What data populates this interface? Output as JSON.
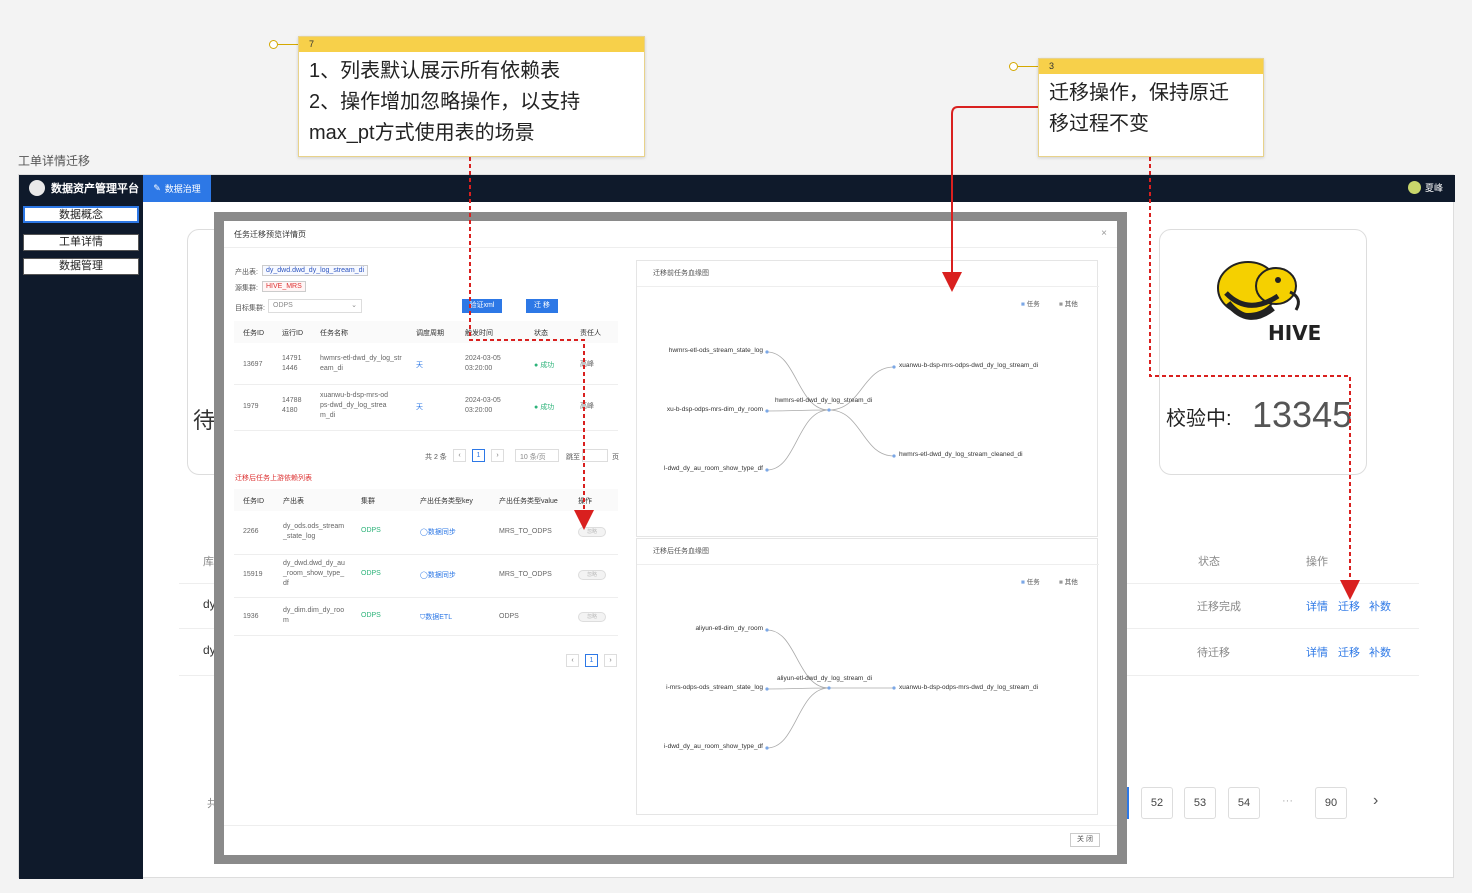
{
  "page_caption": "工单详情迁移",
  "app": {
    "brand": "数据资产管理平台",
    "top_tab": "数据治理",
    "user_name": "夏峰",
    "sidebar": [
      "数据概念",
      "工单详情",
      "数据管理"
    ]
  },
  "background": {
    "wait_label": "待",
    "verifying_label": "校验中:",
    "verifying_count": "13345",
    "hive_logo_text": "HIVE",
    "col_ku": "库",
    "col_status": "状态",
    "col_ops": "操作",
    "rows": [
      {
        "prefix": "dy",
        "status": "迁移完成",
        "ops": [
          "详情",
          "迁移",
          "补数"
        ]
      },
      {
        "prefix": "dy",
        "status": "待迁移",
        "ops": [
          "详情",
          "迁移",
          "补数"
        ]
      }
    ],
    "total_prefix": "共",
    "pages": [
      "52",
      "53",
      "54",
      "···",
      "90"
    ],
    "next_icon": "chevron-right-icon"
  },
  "modal": {
    "title": "任务迁移预览详情页",
    "close_icon": "×",
    "output_table_label": "产出表:",
    "output_table_value": "dy_dwd.dwd_dy_log_stream_di",
    "source_cluster_label": "源集群:",
    "source_cluster_value": "HIVE_MRS",
    "target_cluster_label": "目标集群:",
    "target_cluster_value": "ODPS",
    "btn_verify": "验证xml",
    "btn_migrate": "迁 移",
    "task_table": {
      "headers": [
        "任务ID",
        "运行ID",
        "任务名称",
        "调度周期",
        "触发时间",
        "状态",
        "责任人"
      ],
      "rows": [
        {
          "task_id": "13697",
          "run_id": "14791 1446",
          "name": "hwmrs-etl-dwd_dy_log_stream_di",
          "cycle": "天",
          "time": "2024-03-05 03:20:00",
          "status": "成功",
          "owner": "高峰"
        },
        {
          "task_id": "1979",
          "run_id": "14788 4180",
          "name": "xuanwu-b-dsp-mrs-odps-dwd_dy_log_stream_di",
          "cycle": "天",
          "time": "2024-03-05 03:20:00",
          "status": "成功",
          "owner": "高峰"
        }
      ],
      "total": "共 2 条",
      "page": "1",
      "page_size": "10 条/页",
      "goto": "跳至",
      "page_suffix": "页"
    },
    "dep_title": "迁移后任务上游依赖列表",
    "dep_table": {
      "headers": [
        "任务ID",
        "产出表",
        "集群",
        "产出任务类型key",
        "产出任务类型value",
        "操作"
      ],
      "rows": [
        {
          "task_id": "2266",
          "table": "dy_ods.ods_stream_state_log",
          "cluster": "ODPS",
          "type_key": "数据同步",
          "type_value": "MRS_TO_ODPS",
          "op": "忽略"
        },
        {
          "task_id": "15919",
          "table": "dy_dwd.dwd_dy_au_room_show_type_df",
          "cluster": "ODPS",
          "type_key": "数据同步",
          "type_value": "MRS_TO_ODPS",
          "op": "忽略"
        },
        {
          "task_id": "1936",
          "table": "dy_dim.dim_dy_room",
          "cluster": "ODPS",
          "type_key": "数据ETL",
          "type_value": "ODPS",
          "op": "忽略"
        }
      ],
      "page": "1"
    },
    "graph_before": {
      "title": "迁移前任务血缘图",
      "legend": [
        "任务",
        "其他"
      ],
      "center": "hwmrs-etl-dwd_dy_log_stream_di",
      "left": [
        "hwmrs-etl-ods_stream_state_log",
        "xu-b-dsp-odps-mrs-dim_dy_room",
        "l-dwd_dy_au_room_show_type_df"
      ],
      "right": [
        "xuanwu-b-dsp-mrs-odps-dwd_dy_log_stream_di",
        "hwmrs-etl-dwd_dy_log_stream_cleaned_di"
      ]
    },
    "graph_after": {
      "title": "迁移后任务血缘图",
      "legend": [
        "任务",
        "其他"
      ],
      "center": "aliyun-etl-dwd_dy_log_stream_di",
      "left": [
        "aliyun-etl-dim_dy_room",
        "i-mrs-odps-ods_stream_state_log",
        "i-dwd_dy_au_room_show_type_df"
      ],
      "right": [
        "xuanwu-b-dsp-odps-mrs-dwd_dy_log_stream_di"
      ]
    },
    "footer_close": "关 闭"
  },
  "callouts": [
    {
      "number": "7",
      "lines": [
        "1、列表默认展示所有依赖表",
        "2、操作增加忽略操作，以支持",
        "max_pt方式使用表的场景"
      ]
    },
    {
      "number": "3",
      "lines": [
        "迁移操作，保持原迁",
        "移过程不变"
      ]
    }
  ],
  "colors": {
    "accent": "#2d78e6",
    "nav": "#0f1a2b",
    "callout": "#f7d04a",
    "arrow": "#d9201f"
  }
}
